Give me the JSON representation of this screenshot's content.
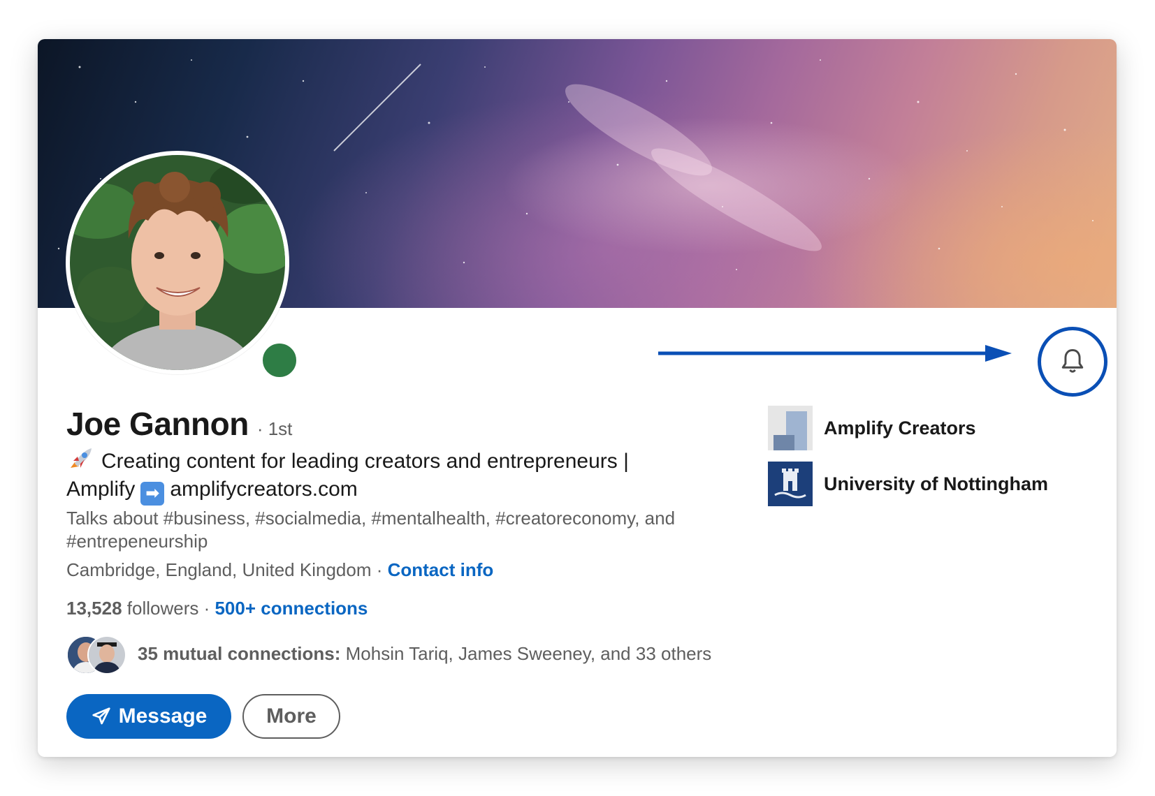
{
  "profile": {
    "name": "Joe Gannon",
    "degree": "· 1st",
    "headline_line1": "Creating content for leading creators and entrepreneurs |",
    "headline_amplify": "Amplify",
    "headline_arrow_glyph": "➡",
    "headline_site": "amplifycreators.com",
    "talks_about": "Talks about #business, #socialmedia, #mentalhealth, #creatoreconomy, and #entrepeneurship",
    "location": "Cambridge, England, United Kingdom",
    "location_sep": " · ",
    "contact_info": "Contact info",
    "online_status": "online"
  },
  "stats": {
    "followers_count": "13,528",
    "followers_label": " followers",
    "sep": " · ",
    "connections": "500+ connections"
  },
  "mutual": {
    "label": "35 mutual connections:",
    "names": " Mohsin Tariq, James Sweeney, and 33 others"
  },
  "actions": {
    "message_label": "Message",
    "more_label": "More"
  },
  "orgs": [
    {
      "name": "Amplify Creators",
      "logo": "amplify-logo"
    },
    {
      "name": "University of Nottingham",
      "logo": "nottingham-crest"
    }
  ],
  "icons": {
    "bell": "bell-icon",
    "send": "send-icon",
    "rocket": "rocket-emoji",
    "arrow": "right-arrow-emoji"
  },
  "colors": {
    "link": "#0a66c2",
    "online": "#2e7d45",
    "annotation": "#0a4fb5",
    "text_primary": "#191919",
    "text_secondary": "#5e5e5e"
  }
}
